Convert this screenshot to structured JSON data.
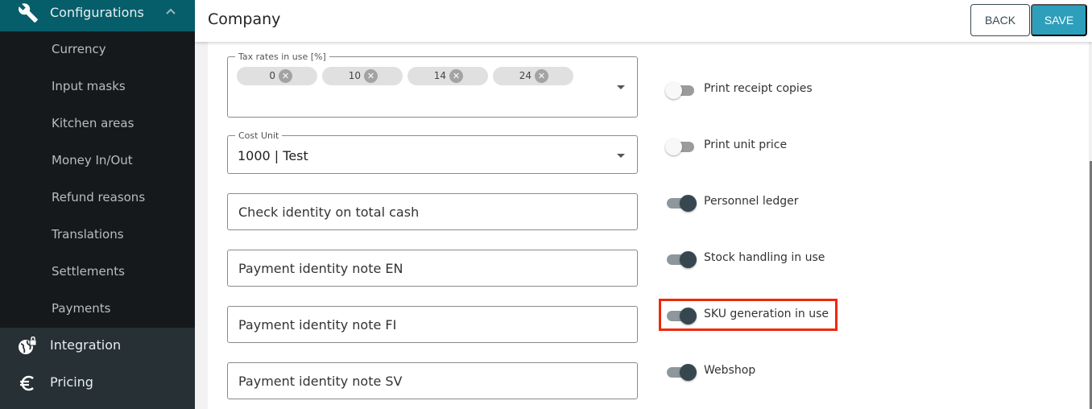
{
  "sidebar": {
    "section": {
      "label": "Configurations",
      "icon": "wrench-icon",
      "expanded": true
    },
    "sub_items": [
      {
        "label": "Currency"
      },
      {
        "label": "Input masks"
      },
      {
        "label": "Kitchen areas"
      },
      {
        "label": "Money In/Out"
      },
      {
        "label": "Refund reasons"
      },
      {
        "label": "Translations"
      },
      {
        "label": "Settlements"
      },
      {
        "label": "Payments"
      }
    ],
    "items": [
      {
        "label": "Integration",
        "icon": "globe-lock-icon"
      },
      {
        "label": "Pricing",
        "icon": "euro-icon"
      }
    ]
  },
  "header": {
    "title": "Company",
    "back_label": "BACK",
    "save_label": "SAVE"
  },
  "form": {
    "tax_rates": {
      "label": "Tax rates in use [%]",
      "chips": [
        "0",
        "10",
        "14",
        "24"
      ]
    },
    "cost_unit": {
      "label": "Cost Unit",
      "value": "1000 | Test"
    },
    "inputs": [
      {
        "placeholder": "Check identity on total cash"
      },
      {
        "placeholder": "Payment identity note EN"
      },
      {
        "placeholder": "Payment identity note FI"
      },
      {
        "placeholder": "Payment identity note SV"
      }
    ],
    "toggles": [
      {
        "label": "Print receipt copies",
        "on": false
      },
      {
        "label": "Print unit price",
        "on": false
      },
      {
        "label": "Personnel ledger",
        "on": true
      },
      {
        "label": "Stock handling in use",
        "on": true
      },
      {
        "label": "SKU generation in use",
        "on": true,
        "highlighted": true
      },
      {
        "label": "Webshop",
        "on": true
      }
    ]
  },
  "colors": {
    "accent": "#2e9fba",
    "sidebar_active": "#075e6b",
    "highlight": "#f0280a"
  }
}
